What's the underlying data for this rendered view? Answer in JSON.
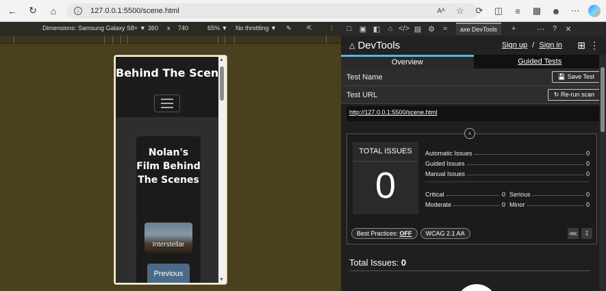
{
  "browser": {
    "url": "127.0.0.1:5500/scene.html",
    "read_aloud": "Aᴬ"
  },
  "device_bar": {
    "dimensions": "Dimensions: Samsung Galaxy S8+ ▼",
    "width": "360",
    "times": "x",
    "height": "740",
    "zoom": "65% ▼",
    "throttling": "No throttling ▼"
  },
  "page": {
    "site_title": "Behind The Scenes",
    "card_title": "Nolan's Film Behind The Scenes",
    "thumbnail_caption": "Interstellar",
    "previous_button": "Previous"
  },
  "devtools": {
    "tab_label": "axe DevTools",
    "brand": "DevTools",
    "sign_up": "Sign up",
    "separator": "/",
    "sign_in": "Sign in",
    "tabs": [
      "Overview",
      "Guided Tests"
    ],
    "test_name_label": "Test Name",
    "save_test": "Save Test",
    "test_url_label": "Test URL",
    "rerun_scan": "Re-run scan",
    "tested_url": "http://127.0.0.1:5500/scene.html",
    "total_issues_label": "TOTAL ISSUES",
    "total_issues_value": "0",
    "automatic_issues_label": "Automatic Issues",
    "automatic_issues_value": "0",
    "guided_issues_label": "Guided Issues",
    "guided_issues_value": "0",
    "manual_issues_label": "Manual Issues",
    "manual_issues_value": "0",
    "critical_label": "Critical",
    "critical_value": "0",
    "serious_label": "Serious",
    "serious_value": "0",
    "moderate_label": "Moderate",
    "moderate_value": "0",
    "minor_label": "Minor",
    "minor_value": "0",
    "best_practices_label": "Best Practices:",
    "best_practices_value": "OFF",
    "standard": "WCAG 2.1 AA",
    "total_issues_footer_label": "Total Issues:",
    "total_issues_footer_value": "0"
  }
}
